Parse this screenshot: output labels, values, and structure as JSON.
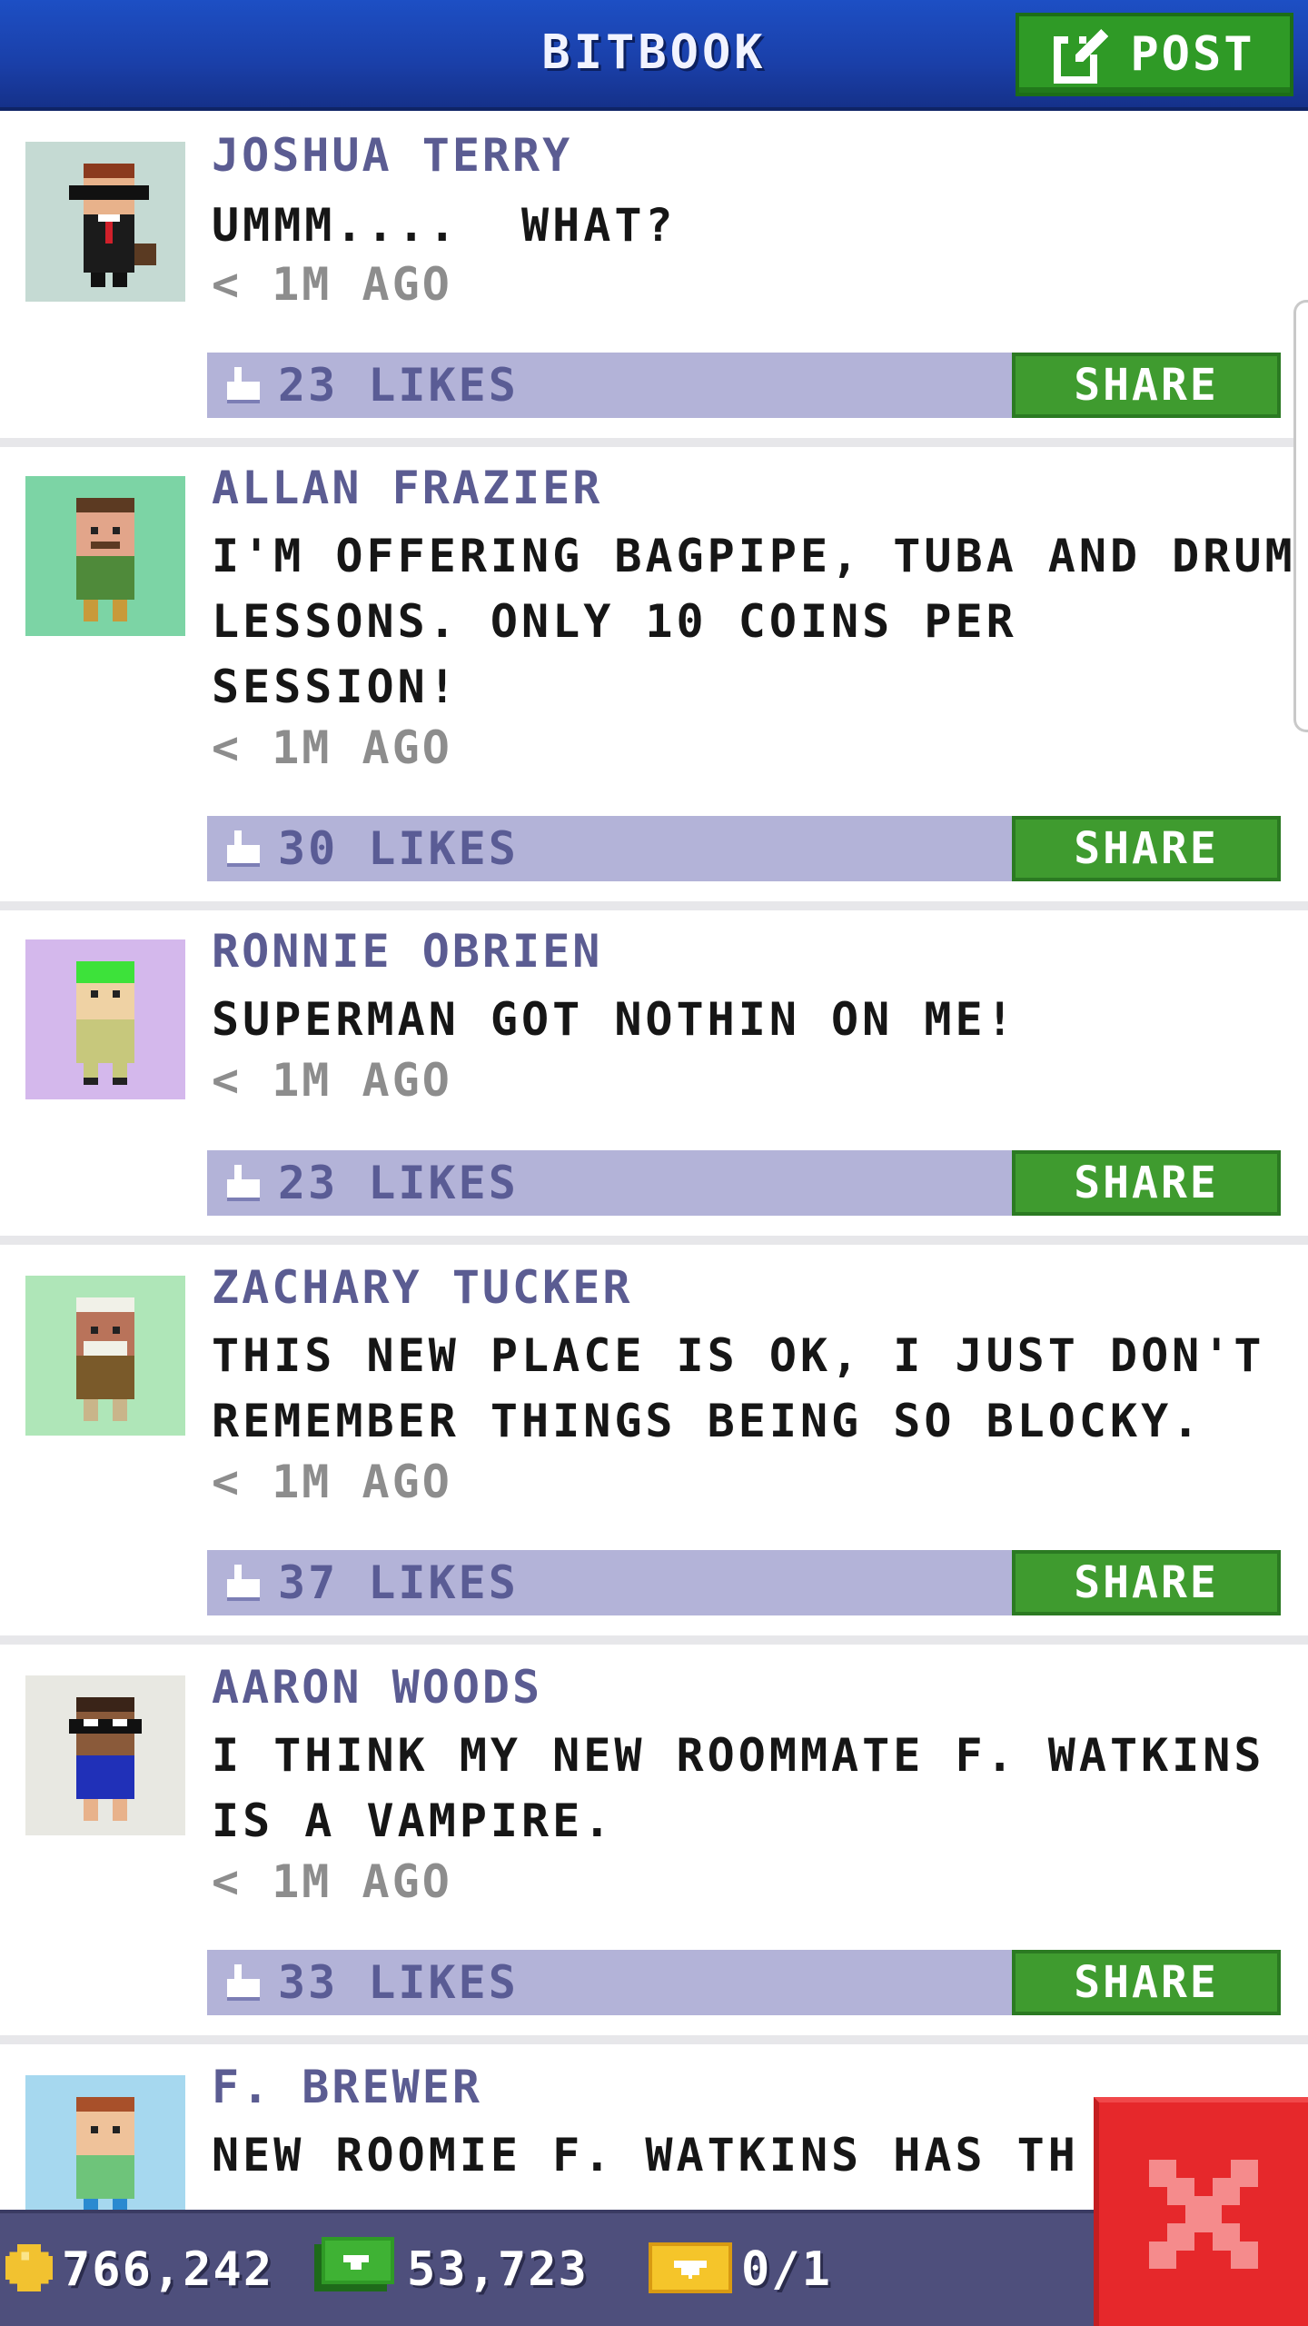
{
  "header": {
    "title": "BITBOOK",
    "post_label": "POST"
  },
  "posts": [
    {
      "author": "JOSHUA TERRY",
      "message": "UMMM....  WHAT?",
      "time": "< 1M AGO",
      "likes": "23 LIKES",
      "share_label": "SHARE",
      "avatar_bg": "#c5dad3"
    },
    {
      "author": "ALLAN FRAZIER",
      "message": "I'M OFFERING BAGPIPE, TUBA AND DRUM\nLESSONS. ONLY 10 COINS PER\nSESSION!",
      "time": "< 1M AGO",
      "likes": "30 LIKES",
      "share_label": "SHARE",
      "avatar_bg": "#7cd4a5"
    },
    {
      "author": "RONNIE OBRIEN",
      "message": "SUPERMAN GOT NOTHIN ON ME!",
      "time": "< 1M AGO",
      "likes": "23 LIKES",
      "share_label": "SHARE",
      "avatar_bg": "#d4b8ec"
    },
    {
      "author": "ZACHARY TUCKER",
      "message": "THIS NEW PLACE IS OK, I JUST DON'T\nREMEMBER THINGS BEING SO BLOCKY.",
      "time": "< 1M AGO",
      "likes": "37 LIKES",
      "share_label": "SHARE",
      "avatar_bg": "#afe6b8"
    },
    {
      "author": "AARON WOODS",
      "message": "I THINK MY NEW ROOMMATE F. WATKINS\nIS A VAMPIRE.",
      "time": "< 1M AGO",
      "likes": "33 LIKES",
      "share_label": "SHARE",
      "avatar_bg": "#e8e8e2"
    },
    {
      "author": "F. BREWER",
      "message": "NEW ROOMIE F. WATKINS HAS TH",
      "time": "",
      "likes": "",
      "share_label": "",
      "avatar_bg": "#a6d8ef"
    }
  ],
  "status": {
    "coins": "766,242",
    "bux": "53,723",
    "tickets": "0/1"
  },
  "colors": {
    "header_blue": "#1a3fa8",
    "share_green": "#3f9b2f",
    "like_bar": "#b3b3d8",
    "author_purple": "#5b5c92",
    "close_red": "#e6282b"
  },
  "icons": {
    "post": "edit-icon",
    "like": "thumbs-up-icon",
    "coin": "coin-icon",
    "bux": "bux-icon",
    "ticket": "ticket-icon",
    "close": "close-icon"
  }
}
